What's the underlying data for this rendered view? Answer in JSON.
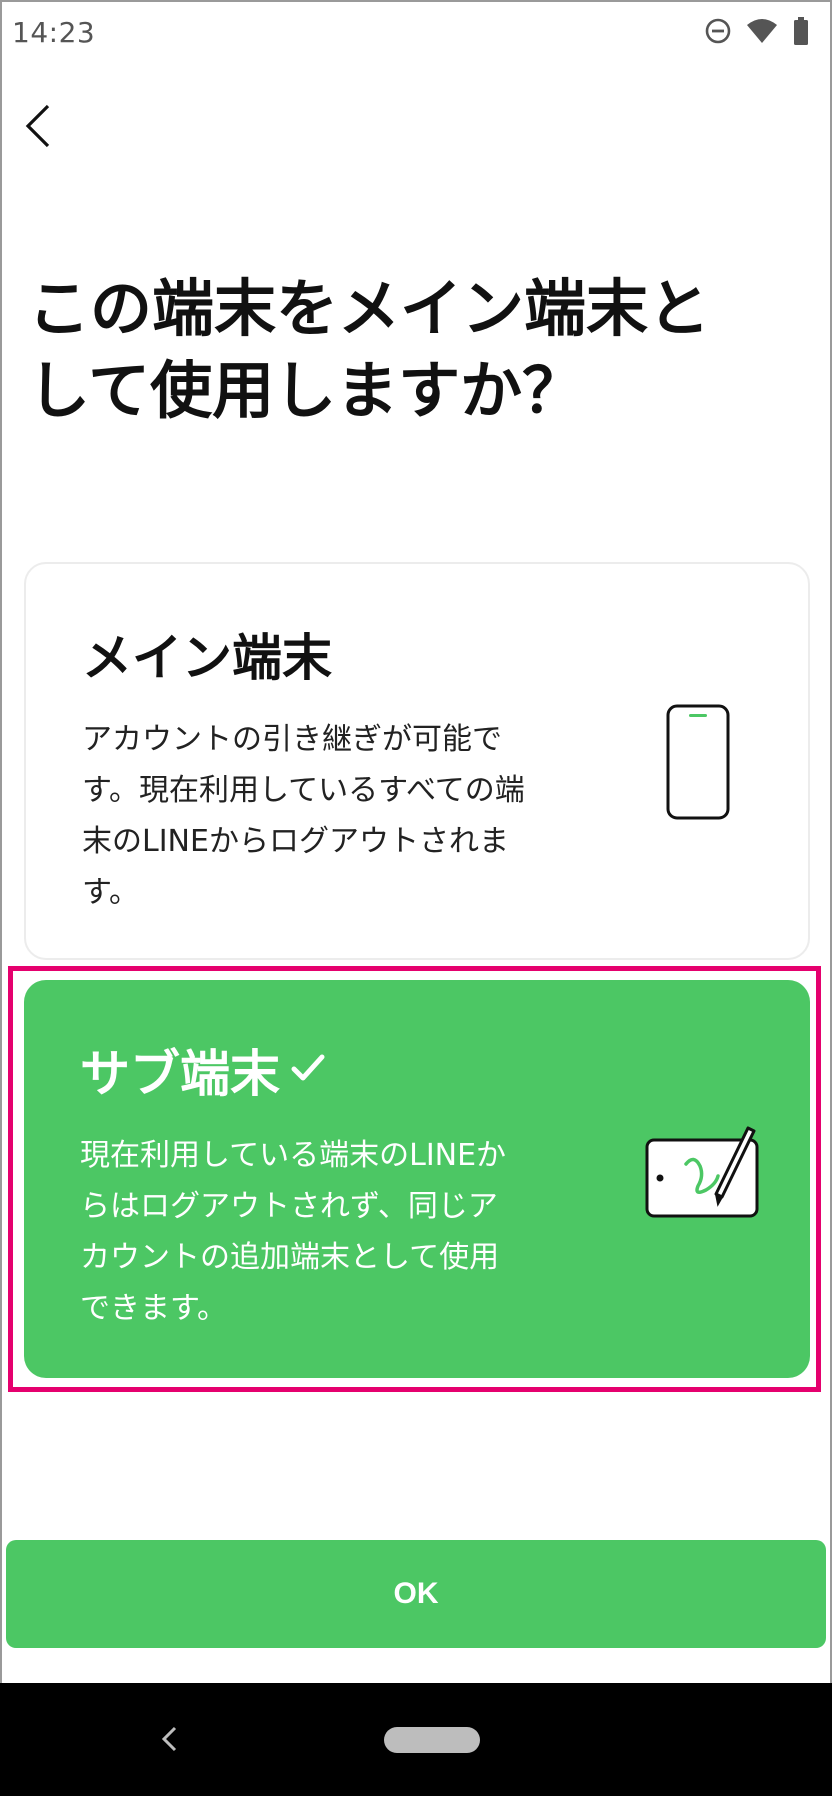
{
  "status_bar": {
    "time": "14:23",
    "icons": [
      "do-not-disturb-icon",
      "wifi-icon",
      "battery-icon"
    ]
  },
  "navigation": {
    "back_icon": "chevron-left-icon"
  },
  "page": {
    "title_line1": "この端末をメイン端末と",
    "title_line2": "して使用しますか？"
  },
  "options": {
    "main": {
      "title": "メイン端末",
      "description_lines": [
        "アカウントの引き継ぎが可能で",
        "す。現在利用しているすべての端",
        "末のLINEからログアウトされま",
        "す。"
      ],
      "icon": "smartphone-icon",
      "selected": false
    },
    "sub": {
      "title": "サブ端末",
      "description_lines": [
        "現在利用している端末のLINEか",
        "らはログアウトされず、同じア",
        "カウントの追加端末として使用",
        "できます。"
      ],
      "icon": "tablet-pen-icon",
      "selected": true,
      "check_icon": "checkmark-icon"
    }
  },
  "actions": {
    "ok_label": "OK"
  },
  "system_nav": {
    "back_icon": "nav-back-icon",
    "home_icon": "nav-home-pill"
  },
  "colors": {
    "accent_green": "#4cc764",
    "highlight_pink": "#e5006e",
    "text_dark": "#111111"
  }
}
